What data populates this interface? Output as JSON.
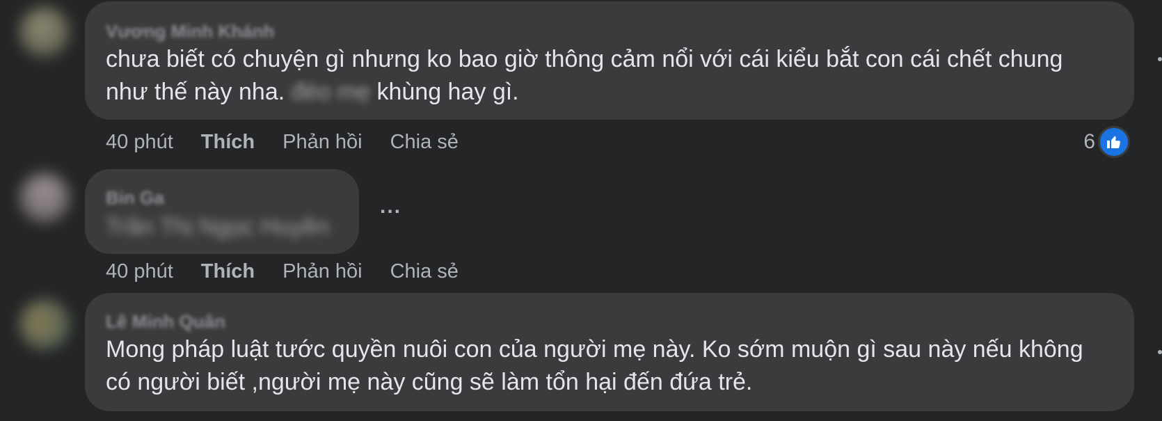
{
  "colors": {
    "background": "#242526",
    "bubble": "#3a3b3c",
    "text": "#e4e6eb",
    "secondary_text": "#b0b3b8",
    "like_blue": "#1b74e4"
  },
  "comments": [
    {
      "author": "Vương Minh Khánh",
      "line1": "chưa biết có chuyện gì nhưng ko bao giờ thông cảm nổi với cái kiểu bắt con cái chết chung",
      "line2_start": "như thế này nha. ",
      "line2_blurred": "đéo mẹ",
      "line2_end": " khùng hay gì.",
      "time": "40 phút",
      "like": "Thích",
      "reply": "Phản hồi",
      "share": "Chia sẻ",
      "reaction_count": "6",
      "reaction_icon": "thumbs-up-icon"
    },
    {
      "author": "Bin Ga",
      "text": "Trần Thị Ngọc Huyền",
      "more": "...",
      "time": "40 phút",
      "like": "Thích",
      "reply": "Phản hồi",
      "share": "Chia sẻ"
    },
    {
      "author": "Lê Minh Quân",
      "line1": "Mong pháp luật tước quyền nuôi con của người mẹ này. Ko sớm muộn gì sau này nếu không",
      "line2": "có người biết ,người mẹ này cũng sẽ làm tổn hại đến đứa trẻ."
    }
  ]
}
